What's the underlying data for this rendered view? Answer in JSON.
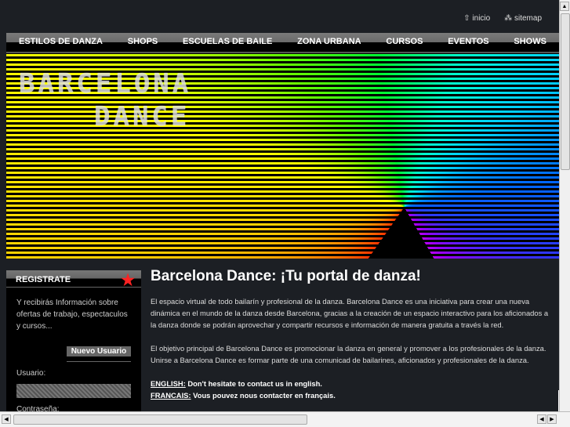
{
  "top_links": [
    {
      "icon": "home-icon",
      "glyph": "⇧",
      "label": "inicio"
    },
    {
      "icon": "sitemap-icon",
      "glyph": "⁂",
      "label": "sitemap"
    }
  ],
  "nav": [
    "ESTILOS DE DANZA",
    "SHOPS",
    "ESCUELAS DE BAILE",
    "ZONA URBANA",
    "CURSOS",
    "EVENTOS",
    "SHOWS"
  ],
  "banner": {
    "logo_line1": "BARCELONA",
    "logo_line2": "DANCE"
  },
  "sidebar": {
    "title": "REGISTRATE",
    "star": "★",
    "text": "Y recibirás Información sobre ofertas de trabajo, espectaculos y cursos...",
    "new_user": "Nuevo Usuario",
    "user_label": "Usuario:",
    "password_label": "Contraseña:"
  },
  "main": {
    "title": "Barcelona Dance: ¡Tu portal de danza!",
    "p1": [
      "El espacio virtual de todo bailarín y profesional de la danza. Barcelona Dance es una iniciativa para crear una nueva",
      "dinámica en el mundo de la danza desde Barcelona, gracias a la creación de un espacio interactivo para los aficionados a",
      "la danza donde se podrán aprovechar y compartir recursos e información de manera gratuita a través la red."
    ],
    "p2": [
      "El objetivo principal de Barcelona Dance es promocionar la danza en general y promover a los profesionales de la danza.",
      "Unirse a Barcelona Dance es formar parte de una comunicad de bailarines, aficionados y profesionales de la danza."
    ],
    "english_label": "ENGLISH:",
    "english_text": " Don't hesitate to contact us in english.",
    "francais_label": "FRANCAIS:",
    "francais_text": " Vous pouvez nous contacter en français."
  },
  "scroll": {
    "up": "▲",
    "down": "▼",
    "left": "◀",
    "right": "▶"
  }
}
